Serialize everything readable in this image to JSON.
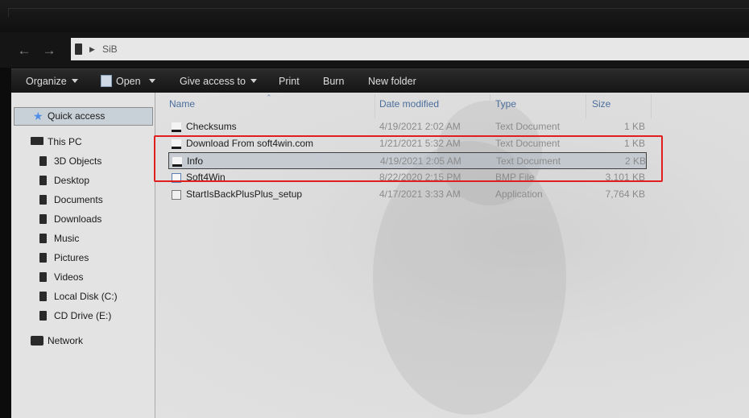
{
  "address": {
    "crumb": "SiB"
  },
  "toolbar": {
    "organize": "Organize",
    "open": "Open",
    "give_access": "Give access to",
    "print": "Print",
    "burn": "Burn",
    "new_folder": "New folder"
  },
  "sidebar": {
    "quick_access": "Quick access",
    "this_pc": "This PC",
    "items": [
      "3D Objects",
      "Desktop",
      "Documents",
      "Downloads",
      "Music",
      "Pictures",
      "Videos",
      "Local Disk (C:)",
      "CD Drive (E:)"
    ],
    "network": "Network"
  },
  "columns": {
    "name": "Name",
    "date": "Date modified",
    "type": "Type",
    "size": "Size"
  },
  "files": [
    {
      "name": "Checksums",
      "date": "4/19/2021 2:02 AM",
      "type": "Text Document",
      "size": "1 KB",
      "icon": "text-file-icon"
    },
    {
      "name": "Download From soft4win.com",
      "date": "1/21/2021 5:32 AM",
      "type": "Text Document",
      "size": "1 KB",
      "icon": "text-file-icon"
    },
    {
      "name": "Info",
      "date": "4/19/2021 2:05 AM",
      "type": "Text Document",
      "size": "2 KB",
      "icon": "text-file-icon"
    },
    {
      "name": "Soft4Win",
      "date": "8/22/2020 2:15 PM",
      "type": "BMP File",
      "size": "3,101 KB",
      "icon": "bitmap-file-icon"
    },
    {
      "name": "StartIsBackPlusPlus_setup",
      "date": "4/17/2021 3:33 AM",
      "type": "Application",
      "size": "7,764 KB",
      "icon": "application-icon"
    }
  ],
  "colors": {
    "highlight_box": "#e01e1e",
    "header_text": "#4b6e9b",
    "selection": "#c9d1d8"
  }
}
